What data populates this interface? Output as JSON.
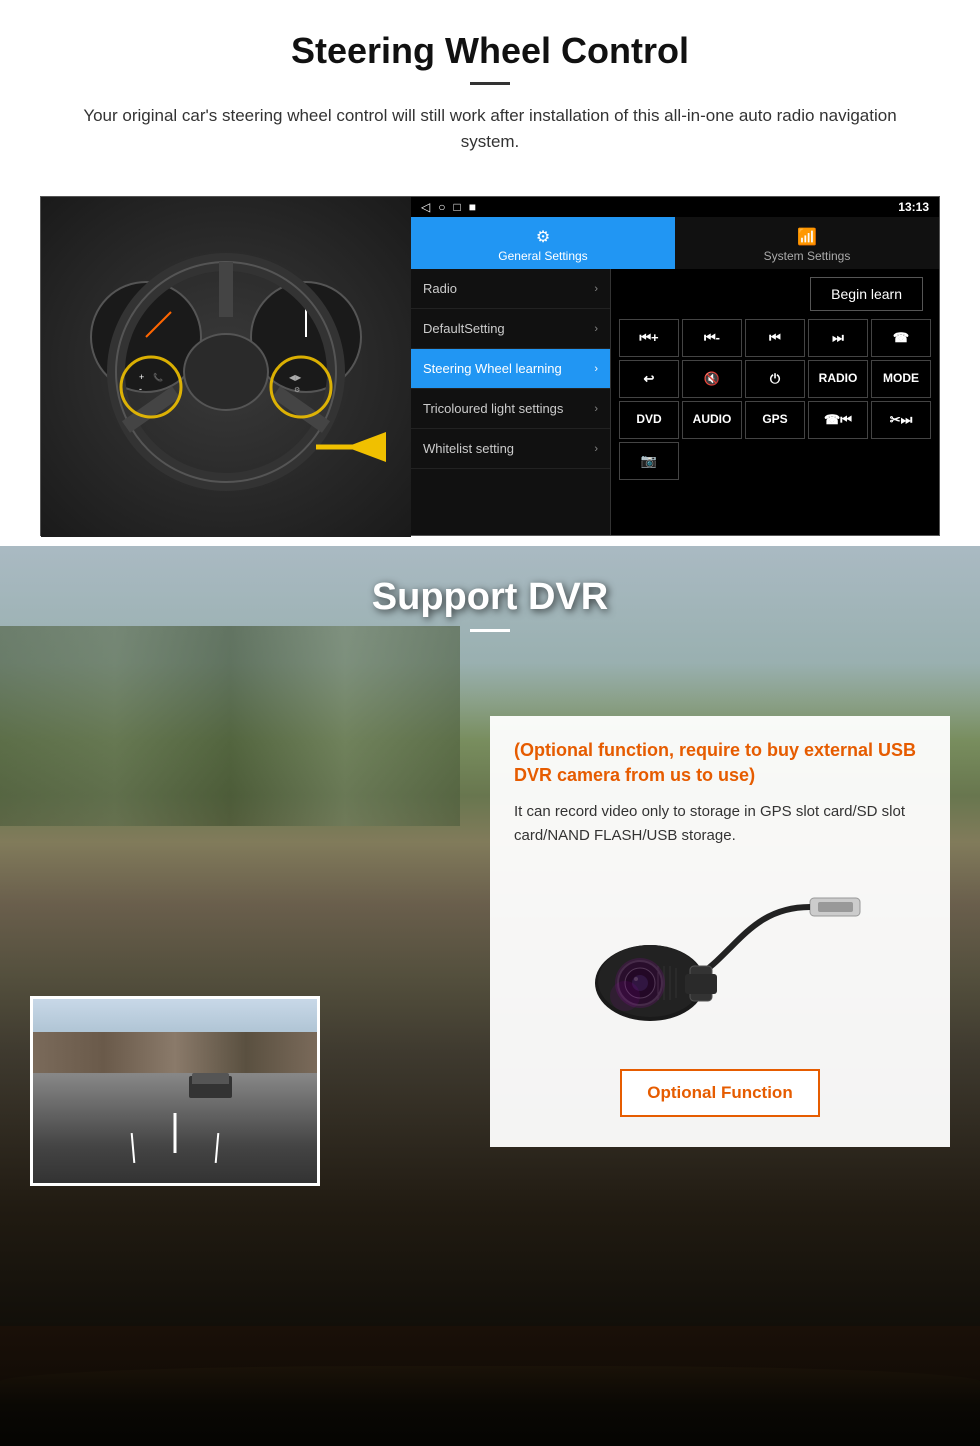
{
  "steering_section": {
    "title": "Steering Wheel Control",
    "subtitle": "Your original car's steering wheel control will still work after installation of this all-in-one auto radio navigation system.",
    "status_bar": {
      "nav_icons": [
        "◁",
        "○",
        "□",
        "■"
      ],
      "signal": "▼",
      "time": "13:13"
    },
    "tabs": [
      {
        "label": "General Settings",
        "active": true,
        "icon": "⚙"
      },
      {
        "label": "System Settings",
        "active": false,
        "icon": "📶"
      }
    ],
    "menu_items": [
      {
        "label": "Radio",
        "active": false
      },
      {
        "label": "DefaultSetting",
        "active": false
      },
      {
        "label": "Steering Wheel learning",
        "active": true
      },
      {
        "label": "Tricoloured light settings",
        "active": false
      },
      {
        "label": "Whitelist setting",
        "active": false
      }
    ],
    "begin_learn": "Begin learn",
    "control_buttons_row1": [
      "⏮+",
      "⏮-",
      "⏮⏮",
      "⏭⏭",
      "📞"
    ],
    "control_buttons_row2": [
      "↩",
      "🔇",
      "⏻",
      "RADIO",
      "MODE"
    ],
    "control_buttons_row3": [
      "DVD",
      "AUDIO",
      "GPS",
      "📞⏮",
      "✂⏭"
    ],
    "control_buttons_row4": [
      "📷"
    ]
  },
  "dvr_section": {
    "title": "Support DVR",
    "optional_title": "(Optional function, require to buy external USB DVR camera from us to use)",
    "description": "It can record video only to storage in GPS slot card/SD slot card/NAND FLASH/USB storage.",
    "optional_function_label": "Optional Function"
  }
}
